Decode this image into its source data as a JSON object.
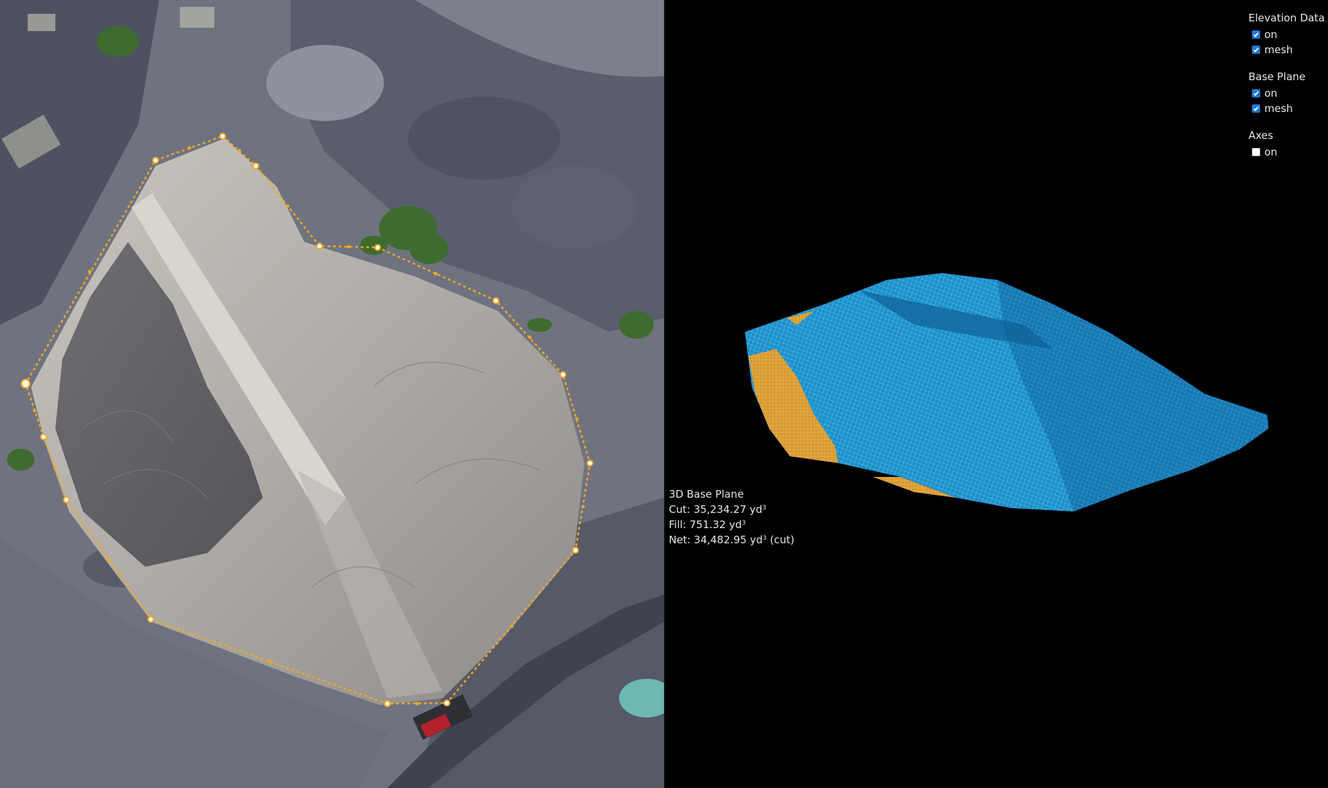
{
  "layers": {
    "elevation": {
      "title": "Elevation Data",
      "items": [
        {
          "label": "on",
          "checked": true
        },
        {
          "label": "mesh",
          "checked": true
        }
      ]
    },
    "base_plane": {
      "title": "Base Plane",
      "items": [
        {
          "label": "on",
          "checked": true
        },
        {
          "label": "mesh",
          "checked": true
        }
      ]
    },
    "axes": {
      "title": "Axes",
      "items": [
        {
          "label": "on",
          "checked": false
        }
      ]
    }
  },
  "volume": {
    "title": "3D Base Plane",
    "cut_label": "Cut: ",
    "cut_value": "35,234.27 yd",
    "fill_label": "Fill: ",
    "fill_value": "751.32 yd",
    "net_label": "Net: ",
    "net_value": "34,482.95 yd",
    "net_suffix": " (cut)",
    "unit_exp": "3"
  },
  "colors": {
    "accent": "#f5a623",
    "mesh_cut": "#1e9ad6",
    "mesh_fill": "#e0a23a",
    "checkbox": "#1f78d1"
  },
  "icons": {
    "measure_vertex": "circle-handle-icon",
    "checkbox": "checkbox-icon"
  }
}
